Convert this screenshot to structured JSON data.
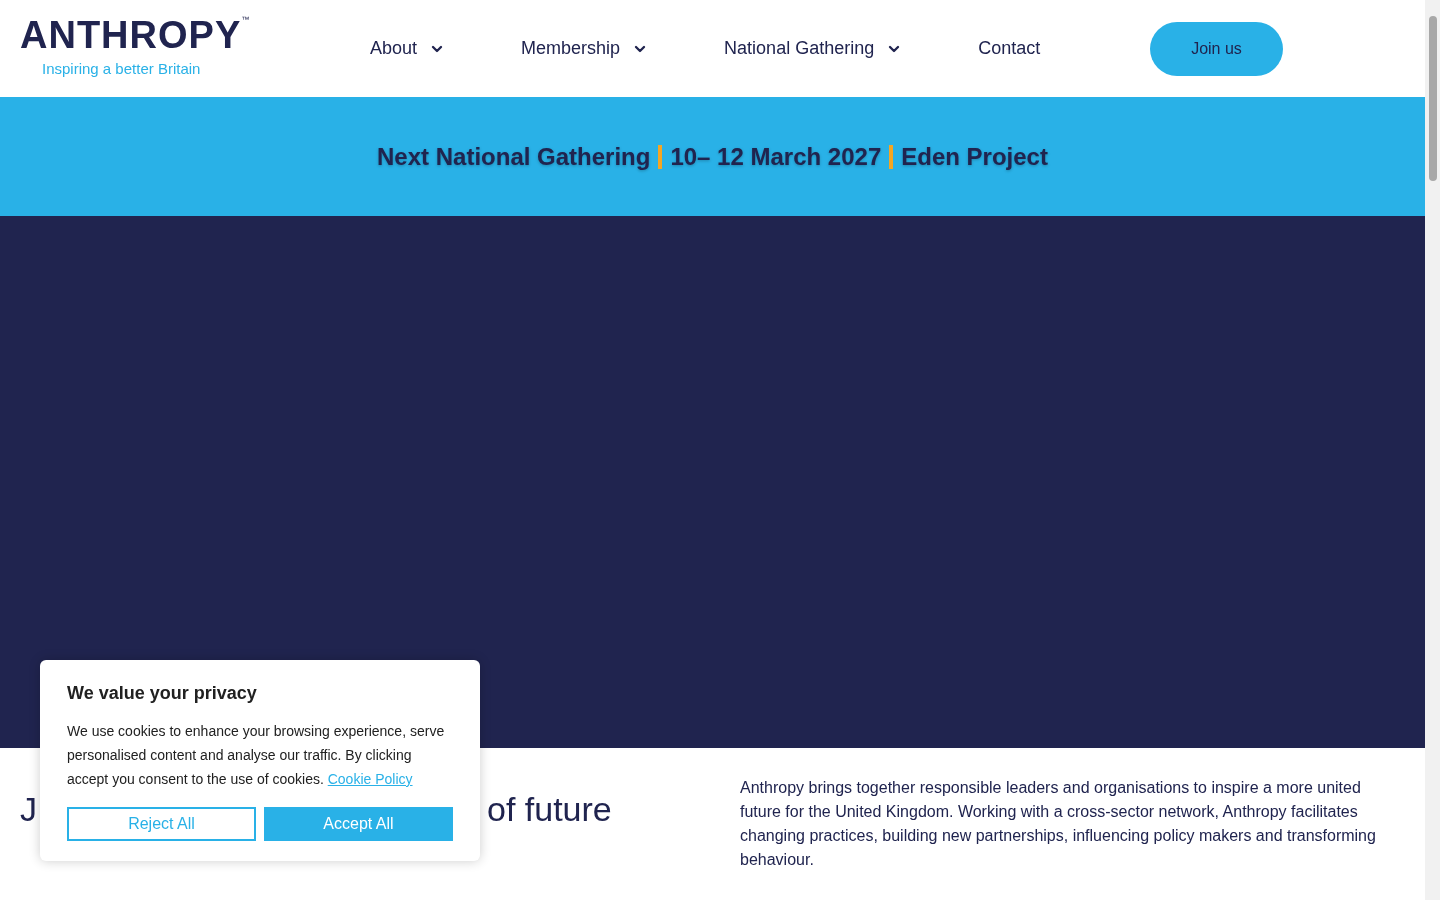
{
  "logo": {
    "wordmark": "ANTHROPY",
    "trademark": "™",
    "tagline": "Inspiring a better Britain"
  },
  "nav": [
    {
      "label": "About",
      "dropdown": true
    },
    {
      "label": "Membership",
      "dropdown": true
    },
    {
      "label": "National Gathering",
      "dropdown": true
    },
    {
      "label": "Contact",
      "dropdown": false
    }
  ],
  "cta": "Join us",
  "announcement": [
    "Next National Gathering",
    "10– 12 March 2027",
    "Eden Project"
  ],
  "intro": {
    "heading_line_1_start": "J",
    "heading_line_1_end": "of future",
    "paragraph": "Anthropy brings together responsible leaders and organisations to inspire a more united future for the United Kingdom. Working with a cross-sector network, Anthropy facilitates changing practices, building new partnerships, influencing policy makers and transforming behaviour."
  },
  "cookie_banner": {
    "title": "We value your privacy",
    "text": "We use cookies to enhance your browsing experience, serve personalised content and analyse our traffic. By clicking accept you consent to the use of cookies.",
    "link": "Cookie Policy",
    "buttons": [
      {
        "kind": "outline",
        "label": "Reject All"
      },
      {
        "kind": "filled",
        "label": "Accept All"
      }
    ]
  }
}
